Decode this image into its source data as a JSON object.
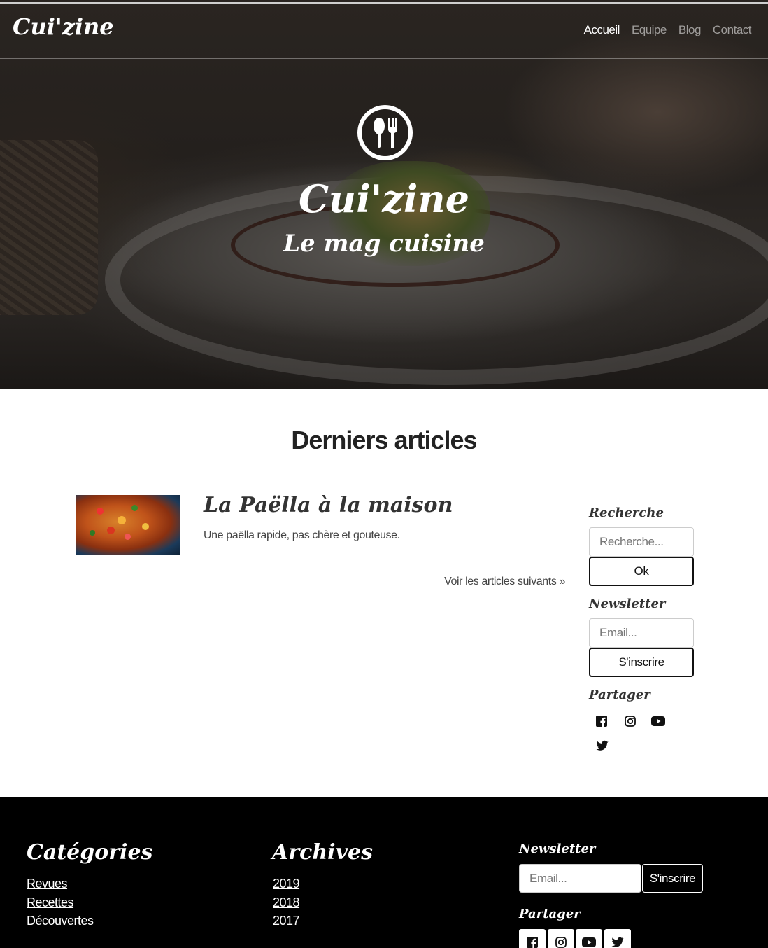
{
  "navbar": {
    "brand": "Cui'zine",
    "links": [
      {
        "label": "Accueil",
        "active": true
      },
      {
        "label": "Equipe",
        "active": false
      },
      {
        "label": "Blog",
        "active": false
      },
      {
        "label": "Contact",
        "active": false
      }
    ]
  },
  "hero": {
    "icon": "spoon-fork-icon",
    "title": "Cui'zine",
    "subtitle": "Le mag cuisine"
  },
  "main": {
    "section_title": "Derniers articles",
    "articles": [
      {
        "title": "La Paëlla à la maison",
        "description": "Une paëlla rapide, pas chère et gouteuse.",
        "image": "paella-image"
      }
    ],
    "next_link": "Voir les articles suivants »"
  },
  "sidebar": {
    "search": {
      "heading": "Recherche",
      "placeholder": "Recherche...",
      "button": "Ok"
    },
    "newsletter": {
      "heading": "Newsletter",
      "placeholder": "Email...",
      "button": "S'inscrire"
    },
    "share": {
      "heading": "Partager",
      "icons": [
        "facebook-icon",
        "instagram-icon",
        "youtube-icon",
        "twitter-icon"
      ]
    }
  },
  "footer": {
    "categories": {
      "heading": "Catégories",
      "links": [
        "Revues",
        "Recettes",
        "Découvertes"
      ]
    },
    "archives": {
      "heading": "Archives",
      "links": [
        "2019",
        "2018",
        "2017"
      ]
    },
    "newsletter": {
      "heading": "Newsletter",
      "placeholder": "Email...",
      "button": "S'inscrire"
    },
    "share": {
      "heading": "Partager"
    }
  },
  "colors": {
    "footer_bg": "#000000",
    "nav_active": "#ffffff",
    "nav_inactive": "#9a9a9a"
  }
}
